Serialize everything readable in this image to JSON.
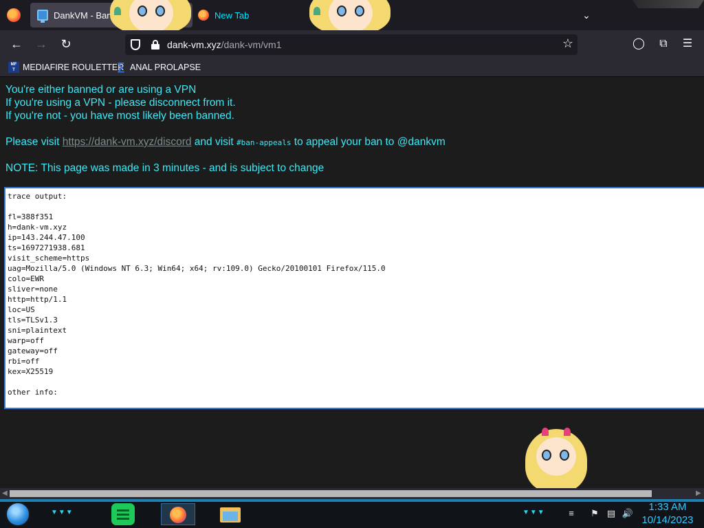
{
  "browser": {
    "tabs": [
      {
        "label": "DankVM - Bann",
        "favicon": "monitor-icon",
        "active": true
      },
      {
        "label": "New Tab",
        "favicon": "firefox-icon",
        "active": false
      }
    ],
    "url_domain": "dank-vm.xyz",
    "url_path": "/dank-vm/vm1"
  },
  "bookmarks": [
    {
      "label": "MEDIAFIRE ROULETTER",
      "icon": "mediafire-icon"
    },
    {
      "label": "ANAL PROLAPSE",
      "icon": "sigma-icon"
    }
  ],
  "page": {
    "line1": "You're either banned or are using a VPN",
    "line2": "If you're using a VPN - please disconnect from it.",
    "line3": "If you're not - you have most likely been banned.",
    "visit_prefix": "Please visit ",
    "visit_link": "https://dank-vm.xyz/discord",
    "visit_middle": " and visit ",
    "visit_channel": "#ban-appeals",
    "visit_suffix": " to appeal your ban to @dankvm",
    "note": "NOTE: This page was made in 3 minutes - and is subject to change",
    "trace": "trace output:\n\nfl=388f351\nh=dank-vm.xyz\nip=143.244.47.100\nts=1697271938.681\nvisit_scheme=https\nuag=Mozilla/5.0 (Windows NT 6.3; Win64; x64; rv:109.0) Gecko/20100101 Firefox/115.0\ncolo=EWR\nsliver=none\nhttp=http/1.1\nloc=US\ntls=TLSv1.3\nsni=plaintext\nwarp=off\ngateway=off\nrbi=off\nkex=X25519\n\nother info:"
  },
  "taskbar": {
    "time": "1:33 AM",
    "date": "10/14/2023"
  },
  "colors": {
    "accent_text": "#3ee8f5",
    "clock": "#38c7ff"
  }
}
